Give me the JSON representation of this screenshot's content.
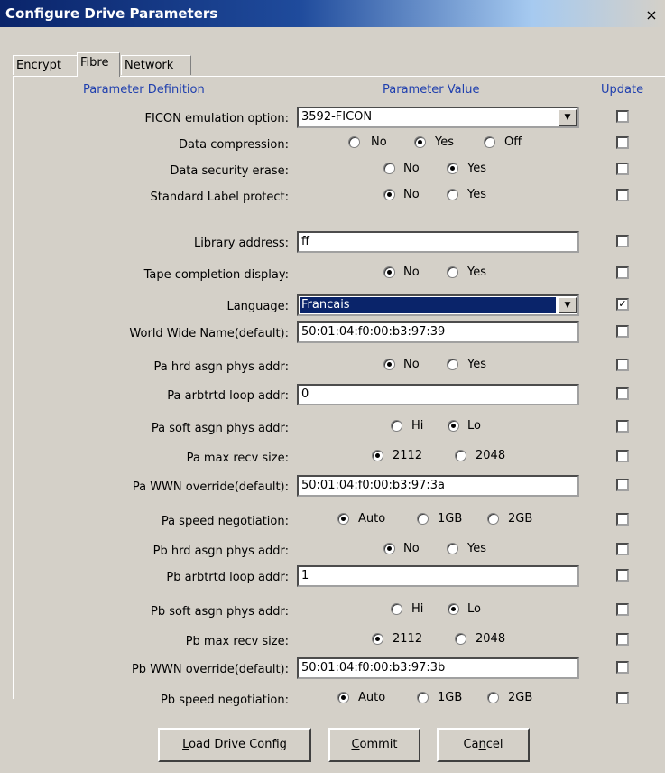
{
  "window": {
    "title": "Configure Drive Parameters",
    "close": "×"
  },
  "tabs": [
    {
      "label": "Encrypt"
    },
    {
      "label": "Fibre"
    },
    {
      "label": "Network"
    }
  ],
  "headers": {
    "definition": "Parameter Definition",
    "value": "Parameter Value",
    "update": "Update"
  },
  "rows": [
    {
      "label": "FICON emulation option:",
      "value": "3592-FICON",
      "update": false
    },
    {
      "label": "Data compression:",
      "options": [
        "No",
        "Yes",
        "Off"
      ],
      "selected": "Yes",
      "update": false
    },
    {
      "label": "Data security erase:",
      "options": [
        "No",
        "Yes"
      ],
      "selected": "Yes",
      "update": false
    },
    {
      "label": "Standard Label protect:",
      "options": [
        "No",
        "Yes"
      ],
      "selected": "No",
      "update": false
    },
    {
      "label": "Library address:",
      "value": "ff",
      "update": false
    },
    {
      "label": "Tape completion display:",
      "options": [
        "No",
        "Yes"
      ],
      "selected": "No",
      "update": false
    },
    {
      "label": "Language:",
      "value": "Francais",
      "update": true
    },
    {
      "label": "World Wide Name(default):",
      "value": "50:01:04:f0:00:b3:97:39",
      "update": false
    },
    {
      "label": "Pa hrd asgn phys addr:",
      "options": [
        "No",
        "Yes"
      ],
      "selected": "No",
      "update": false
    },
    {
      "label": "Pa arbtrtd loop addr:",
      "value": "0",
      "update": false
    },
    {
      "label": "Pa soft asgn phys addr:",
      "options": [
        "Hi",
        "Lo"
      ],
      "selected": "Lo",
      "update": false
    },
    {
      "label": "Pa max recv size:",
      "options": [
        "2112",
        "2048"
      ],
      "selected": "2112",
      "update": false
    },
    {
      "label": "Pa WWN override(default):",
      "value": "50:01:04:f0:00:b3:97:3a",
      "update": false
    },
    {
      "label": "Pa speed negotiation:",
      "options": [
        "Auto",
        "1GB",
        "2GB"
      ],
      "selected": "Auto",
      "update": false
    },
    {
      "label": "Pb hrd asgn phys addr:",
      "options": [
        "No",
        "Yes"
      ],
      "selected": "No",
      "update": false
    },
    {
      "label": "Pb arbtrtd loop addr:",
      "value": "1",
      "update": false
    },
    {
      "label": "Pb soft asgn phys addr:",
      "options": [
        "Hi",
        "Lo"
      ],
      "selected": "Lo",
      "update": false
    },
    {
      "label": "Pb max recv size:",
      "options": [
        "2112",
        "2048"
      ],
      "selected": "2112",
      "update": false
    },
    {
      "label": "Pb WWN override(default):",
      "value": "50:01:04:f0:00:b3:97:3b",
      "update": false
    },
    {
      "label": "Pb speed negotiation:",
      "options": [
        "Auto",
        "1GB",
        "2GB"
      ],
      "selected": "Auto",
      "update": false
    }
  ],
  "buttons": {
    "load_pre": "",
    "load_ul": "L",
    "load_post": "oad Drive Config",
    "commit_pre": "",
    "commit_ul": "C",
    "commit_post": "ommit",
    "cancel_pre": "Ca",
    "cancel_ul": "n",
    "cancel_post": "cel"
  }
}
